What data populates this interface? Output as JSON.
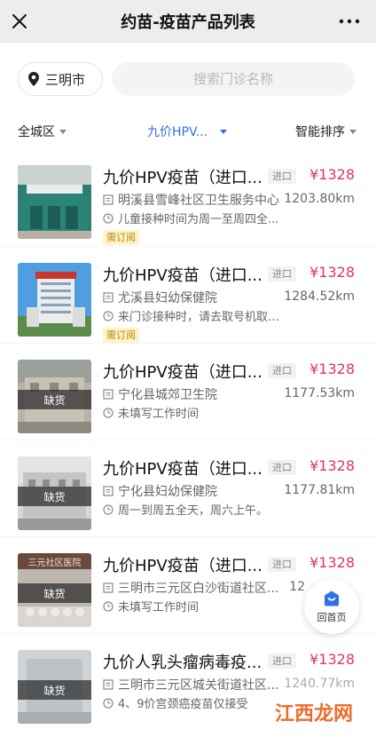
{
  "header": {
    "title": "约苗-疫苗产品列表",
    "close_icon": "close-icon",
    "more_icon": "more-icon"
  },
  "location": {
    "city": "三明市",
    "icon": "map-pin-icon"
  },
  "search": {
    "placeholder": "搜索门诊名称"
  },
  "filters": {
    "district": "全城区",
    "vaccine": "九价HPV...",
    "sort": "智能排序",
    "active_color": "#3a6fd8"
  },
  "items": [
    {
      "name": "九价HPV疫苗（进口...",
      "tag": "进口",
      "price": "¥1328",
      "clinic": "明溪县雪峰社区卫生服务中心",
      "distance": "1203.80km",
      "hours": "儿童接种时间为周一至周四全...",
      "booking": "需订阅",
      "stock_badge": ""
    },
    {
      "name": "九价HPV疫苗（进口...",
      "tag": "进口",
      "price": "¥1328",
      "clinic": "尤溪县妇幼保健院",
      "distance": "1284.52km",
      "hours": "来门诊接种时，请去取号机取号。工作时",
      "booking": "需订阅",
      "stock_badge": ""
    },
    {
      "name": "九价HPV疫苗（进口...",
      "tag": "进口",
      "price": "¥1328",
      "clinic": "宁化县城郊卫生院",
      "distance": "1177.53km",
      "hours": "未填写工作时间",
      "booking": "",
      "stock_badge": "缺货"
    },
    {
      "name": "九价HPV疫苗（进口...",
      "tag": "进口",
      "price": "¥1328",
      "clinic": "宁化县妇幼保健院",
      "distance": "1177.81km",
      "hours": "周一到周五全天，周六上午。",
      "booking": "",
      "stock_badge": "缺货"
    },
    {
      "name": "九价HPV疫苗（进口...",
      "tag": "进口",
      "price": "¥1328",
      "clinic": "三明市三元区白沙街道社区...",
      "distance": "12",
      "hours": "未填写工作时间",
      "booking": "",
      "stock_badge": "缺货"
    },
    {
      "name": "九价人乳头瘤病毒疫...",
      "tag": "进口",
      "price": "¥1328",
      "clinic": "三明市三元区城关街道社区...",
      "distance": "1240.77km",
      "hours": "4、9价宫颈癌疫苗仅接受",
      "booking": "",
      "stock_badge": "缺货"
    }
  ],
  "thumb2_sign": "三明市...",
  "thumb5_sign": "三元社区医院",
  "home_button": {
    "label": "回首页",
    "icon": "home-icon"
  },
  "watermark": "江西龙网",
  "colors": {
    "price": "#e0365d",
    "topbar_bg": "#ededed",
    "booking_bg": "#fff3c8"
  }
}
